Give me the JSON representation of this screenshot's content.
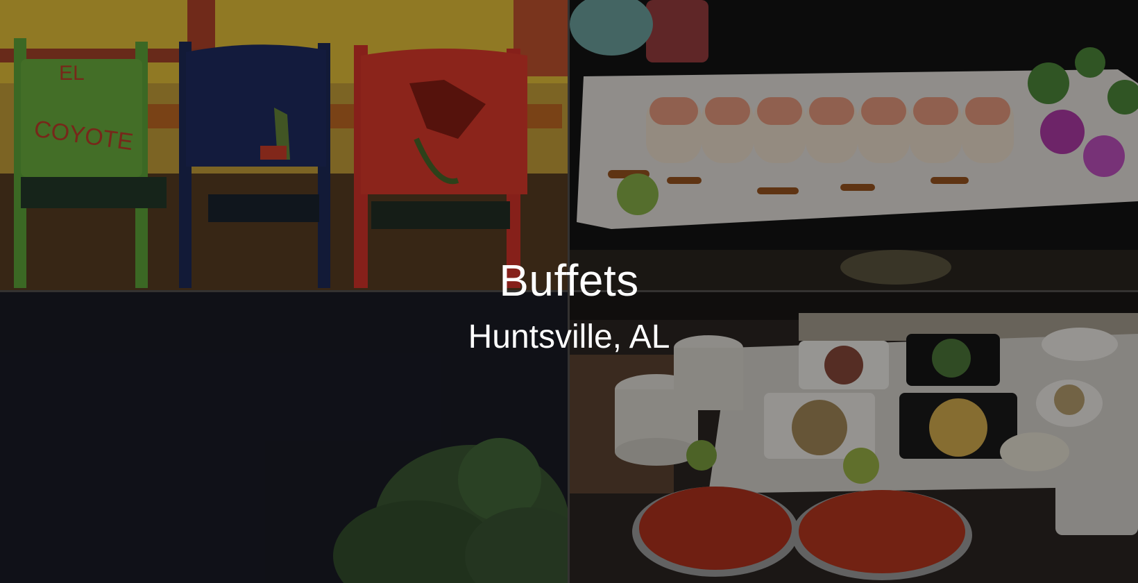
{
  "hero": {
    "title": "Buffets",
    "subtitle": "Huntsville, AL"
  },
  "photos": {
    "top_left": {
      "chair_text_line1": "EL",
      "chair_text_line2": "COYOTE"
    },
    "top_right": {},
    "bottom_left": {},
    "bottom_right": {}
  },
  "colors": {
    "overlay": "rgba(0,0,0,0.38)",
    "text": "#ffffff",
    "gutter": "#55524f"
  }
}
